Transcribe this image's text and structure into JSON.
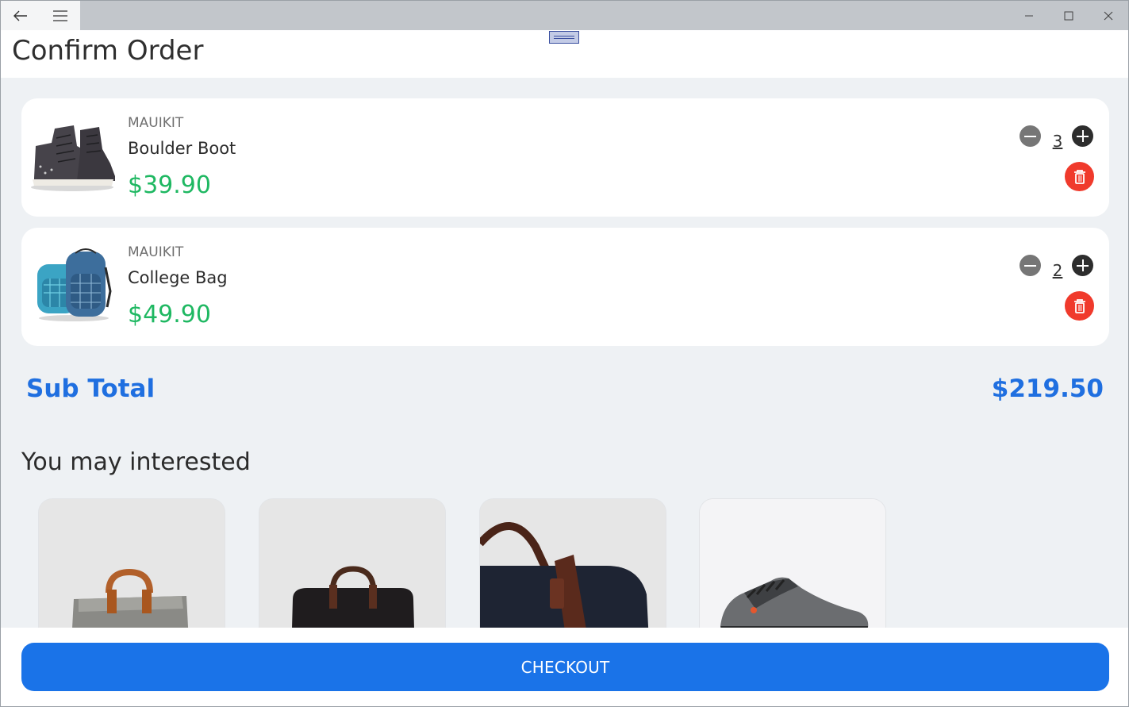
{
  "window": {
    "back_icon": "arrow-left-icon",
    "menu_icon": "hamburger-menu-icon",
    "controls": [
      "minimize-icon",
      "maximize-icon",
      "close-icon"
    ]
  },
  "header": {
    "title": "Confirm Order"
  },
  "cart": {
    "items": [
      {
        "brand": "MAUIKIT",
        "name": "Boulder Boot",
        "price": "$39.90",
        "quantity": "3",
        "image": "boot-image"
      },
      {
        "brand": "MAUIKIT",
        "name": "College Bag",
        "price": "$49.90",
        "quantity": "2",
        "image": "backpack-image"
      }
    ],
    "subtotal_label": "Sub Total",
    "subtotal_value": "$219.50"
  },
  "recommendations": {
    "title": "You may interested",
    "items": [
      {
        "image": "grey-tote-bag-image"
      },
      {
        "image": "black-duffel-bag-image"
      },
      {
        "image": "navy-duffel-bag-closeup-image"
      },
      {
        "image": "knit-sneaker-image"
      }
    ]
  },
  "footer": {
    "checkout_label": "CHECKOUT"
  },
  "colors": {
    "accent": "#1a73e8",
    "price": "#1fb862",
    "delete": "#f03a2c",
    "background": "#eef1f4"
  }
}
